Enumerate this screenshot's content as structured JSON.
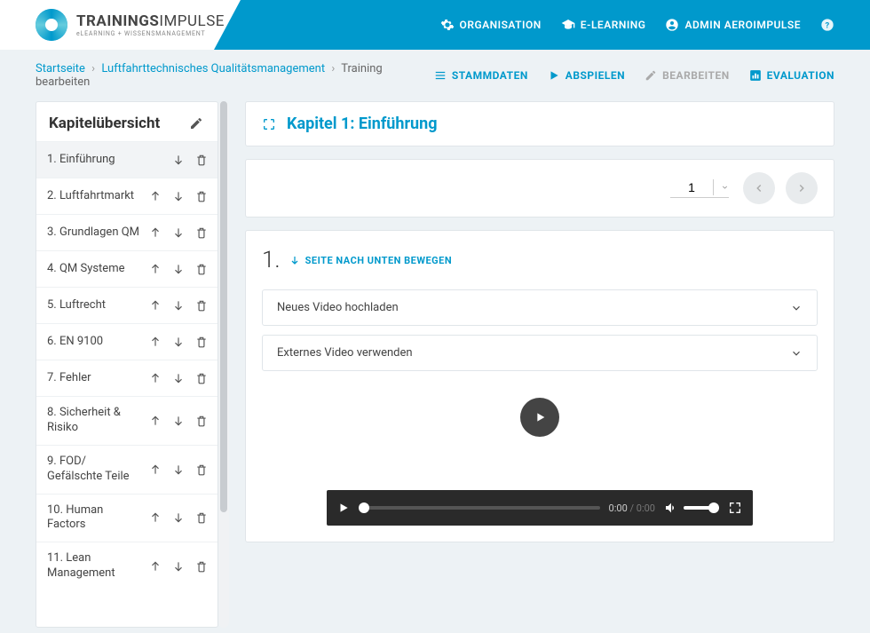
{
  "logo": {
    "main_bold": "TRAININGS",
    "main_light": "IMPULSE",
    "sub": "eLEARNING + WISSENSMANAGEMENT"
  },
  "nav": {
    "org": "ORGANISATION",
    "elearning": "E-LEARNING",
    "user": "ADMIN AEROIMPULSE"
  },
  "breadcrumbs": {
    "home": "Startseite",
    "course": "Luftfahrttechnisches Qualitätsmanagement",
    "current": "Training bearbeiten"
  },
  "toolbar": {
    "stammdaten": "STAMMDATEN",
    "abspielen": "ABSPIELEN",
    "bearbeiten": "BEARBEITEN",
    "evaluation": "EVALUATION"
  },
  "sidebar": {
    "title": "Kapitelübersicht",
    "chapters": [
      {
        "label": "1. Einführung",
        "up": false,
        "down": true,
        "active": true
      },
      {
        "label": "2. Luftfahrtmarkt",
        "up": true,
        "down": true,
        "active": false
      },
      {
        "label": "3. Grundlagen QM",
        "up": true,
        "down": true,
        "active": false
      },
      {
        "label": "4. QM Systeme",
        "up": true,
        "down": true,
        "active": false
      },
      {
        "label": "5. Luftrecht",
        "up": true,
        "down": true,
        "active": false
      },
      {
        "label": "6. EN 9100",
        "up": true,
        "down": true,
        "active": false
      },
      {
        "label": "7. Fehler",
        "up": true,
        "down": true,
        "active": false
      },
      {
        "label": "8. Sicherheit & Risiko",
        "up": true,
        "down": true,
        "active": false
      },
      {
        "label": "9. FOD/ Gefälschte Teile",
        "up": true,
        "down": true,
        "active": false
      },
      {
        "label": "10. Human Factors",
        "up": true,
        "down": true,
        "active": false
      },
      {
        "label": "11. Lean Management",
        "up": true,
        "down": true,
        "active": false
      }
    ]
  },
  "content": {
    "chapter_title": "Kapitel 1: Einführung",
    "pager_value": "1",
    "page_number": "1.",
    "move_down": "SEITE NACH UNTEN BEWEGEN",
    "accordion": {
      "upload_video": "Neues Video hochladen",
      "external_video": "Externes Video verwenden"
    },
    "video": {
      "current_time": "0:00",
      "total_time": "0:00"
    }
  }
}
